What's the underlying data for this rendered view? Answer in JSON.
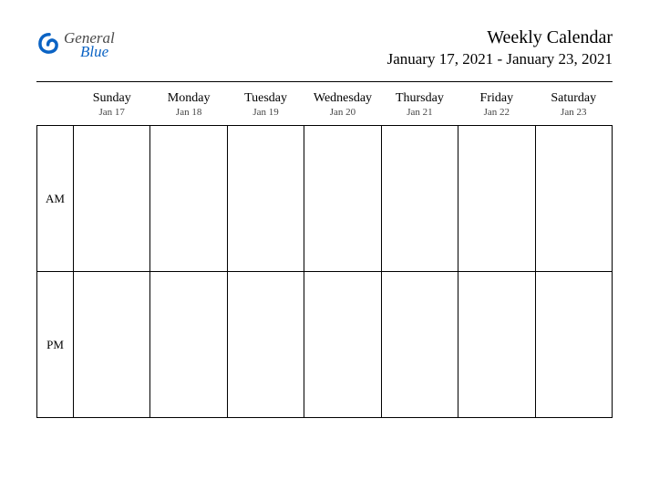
{
  "logo": {
    "line1": "General",
    "line2": "Blue"
  },
  "header": {
    "title": "Weekly Calendar",
    "range": "January 17, 2021 - January 23, 2021"
  },
  "days": [
    {
      "name": "Sunday",
      "date": "Jan 17"
    },
    {
      "name": "Monday",
      "date": "Jan 18"
    },
    {
      "name": "Tuesday",
      "date": "Jan 19"
    },
    {
      "name": "Wednesday",
      "date": "Jan 20"
    },
    {
      "name": "Thursday",
      "date": "Jan 21"
    },
    {
      "name": "Friday",
      "date": "Jan 22"
    },
    {
      "name": "Saturday",
      "date": "Jan 23"
    }
  ],
  "periods": [
    "AM",
    "PM"
  ]
}
